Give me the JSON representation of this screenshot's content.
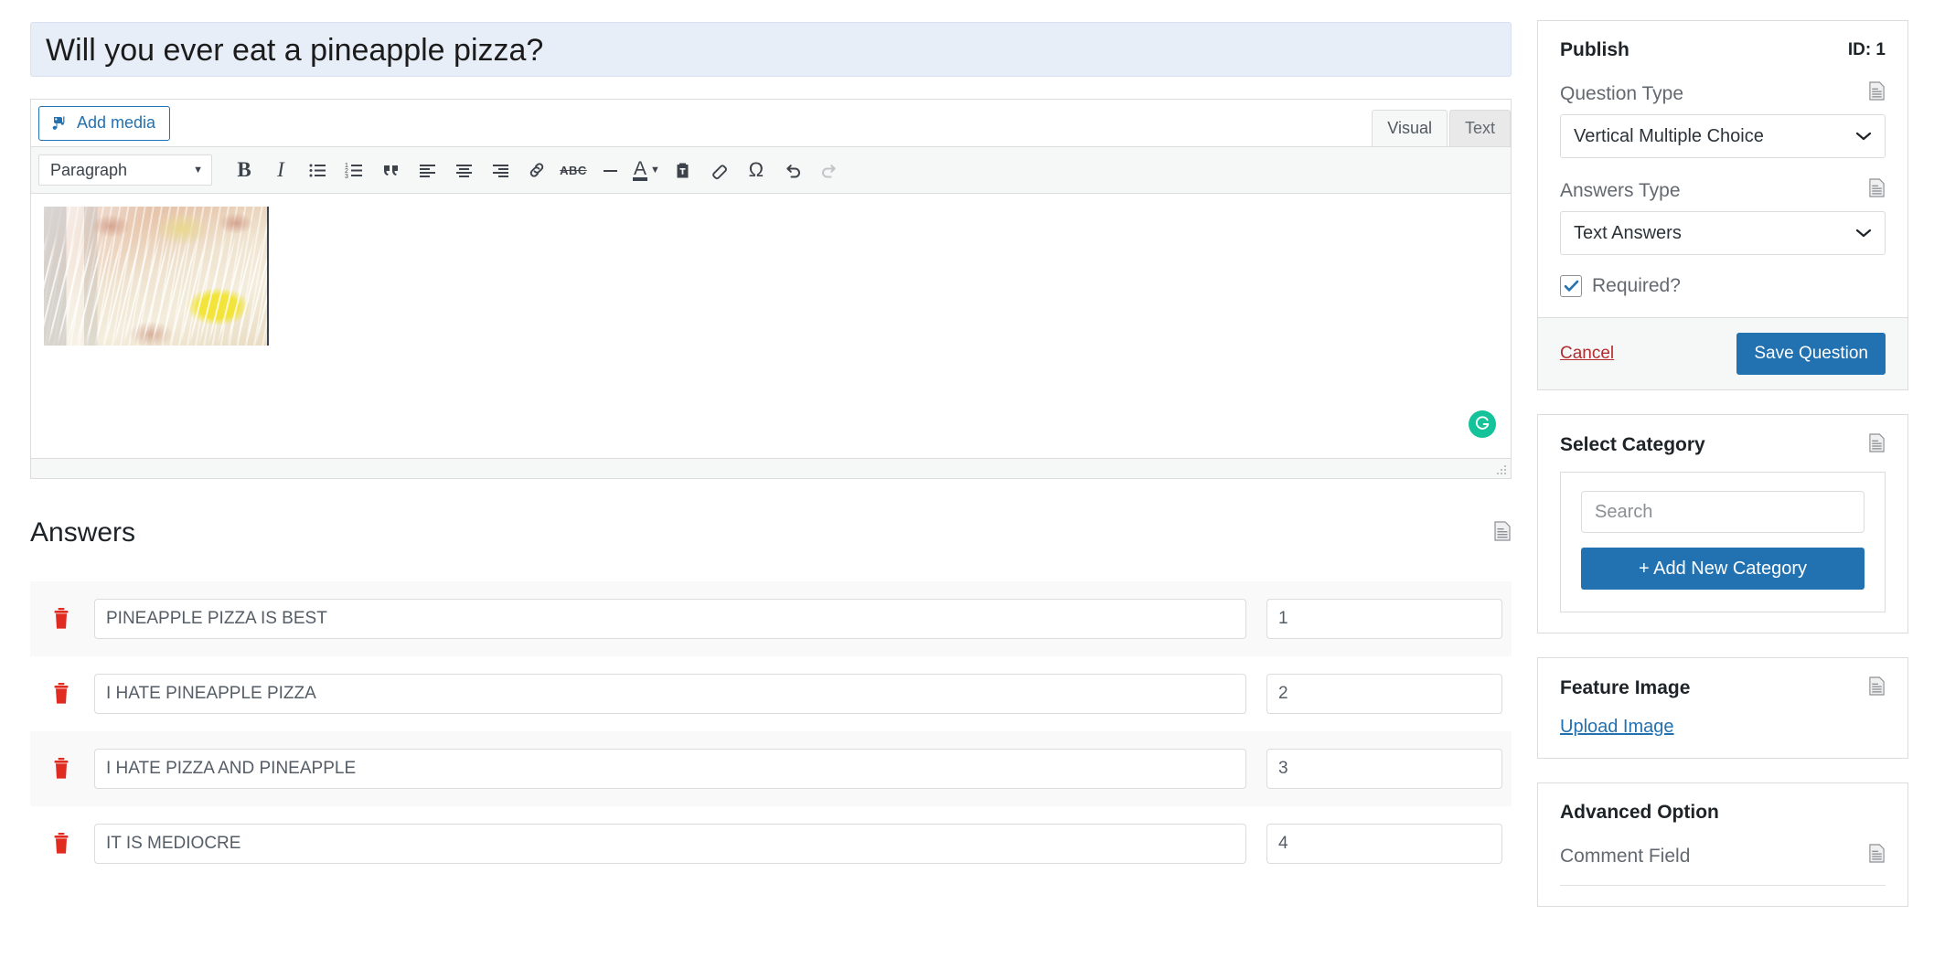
{
  "editor": {
    "question_title": "Will you ever eat a pineapple pizza?",
    "add_media_label": "Add media",
    "tabs": {
      "visual": "Visual",
      "text": "Text"
    },
    "toolbar": {
      "format_select": "Paragraph",
      "bold": "B",
      "italic": "I",
      "bullet_list": "bullet-list-icon",
      "numbered_list": "numbered-list-icon",
      "blockquote": "blockquote-icon",
      "align_left": "align-left-icon",
      "align_center": "align-center-icon",
      "align_right": "align-right-icon",
      "link": "link-icon",
      "strikethrough": "ABC",
      "horizontal_rule": "horizontal-rule-icon",
      "text_color": "A",
      "paste_as_text": "paste-as-text-icon",
      "clear_formatting": "eraser-icon",
      "special_character": "Ω",
      "undo": "undo-icon",
      "redo": "redo-icon"
    },
    "grammarly_glyph": "G"
  },
  "answers": {
    "heading": "Answers",
    "rows": [
      {
        "text": "PINEAPPLE PIZZA IS BEST",
        "value": "1"
      },
      {
        "text": "I HATE PINEAPPLE PIZZA",
        "value": "2"
      },
      {
        "text": "I HATE PIZZA AND PINEAPPLE",
        "value": "3"
      },
      {
        "text": "IT IS MEDIOCRE",
        "value": "4"
      }
    ]
  },
  "sidebar": {
    "publish": {
      "title": "Publish",
      "id_label": "ID: 1",
      "question_type_label": "Question Type",
      "question_type_value": "Vertical Multiple Choice",
      "answers_type_label": "Answers Type",
      "answers_type_value": "Text Answers",
      "required_label": "Required?",
      "required_checked": true,
      "cancel_label": "Cancel",
      "save_label": "Save Question"
    },
    "category": {
      "title": "Select Category",
      "search_placeholder": "Search",
      "search_value": "",
      "add_new_label": "+ Add New Category"
    },
    "feature_image": {
      "title": "Feature Image",
      "upload_label": "Upload Image"
    },
    "advanced": {
      "title": "Advanced Option",
      "comment_field_label": "Comment Field"
    }
  },
  "colors": {
    "primary": "#2271b1",
    "danger": "#b32d2e",
    "trash": "#e02b20",
    "title_bg": "#e8eef8",
    "grammarly": "#15c39a"
  }
}
